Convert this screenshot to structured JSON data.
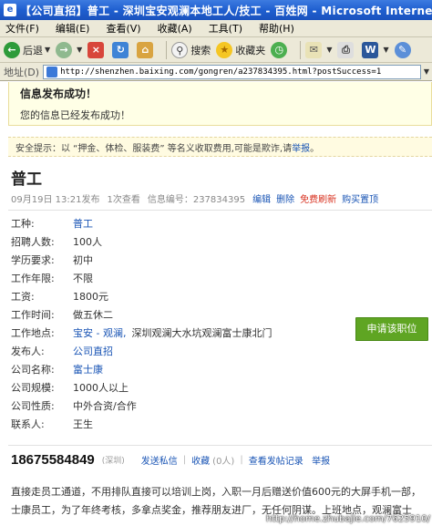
{
  "window": {
    "title": "【公司直招】普工 - 深圳宝安观澜本地工人/技工 - 百姓网 - Microsoft Internet"
  },
  "menu": [
    "文件(F)",
    "编辑(E)",
    "查看(V)",
    "收藏(A)",
    "工具(T)",
    "帮助(H)"
  ],
  "toolbar": {
    "back": "后退",
    "search": "搜索",
    "favorites": "收藏夹"
  },
  "address": {
    "label": "地址(D)",
    "url": "http://shenzhen.baixing.com/gongren/a237834395.html?postSuccess=1"
  },
  "notice": {
    "heading": "信息发布成功！",
    "body": "您的信息已经发布成功！"
  },
  "safety": {
    "text": "安全提示：以 “押金、体检、服装费” 等名义收取费用,可能是欺诈,请",
    "link": "举报",
    "end": "。"
  },
  "post": {
    "title": "普工",
    "date": "09月19日 13:21发布",
    "views": "1次查看",
    "id": "信息编号：237834395",
    "actions": {
      "edit": "编辑",
      "delete": "删除",
      "free_refresh": "免费刷新",
      "buy_top": "购买置顶"
    }
  },
  "fields": [
    {
      "key": "工种:",
      "value": "普工",
      "link": true
    },
    {
      "key": "招聘人数:",
      "value": "100人",
      "link": false
    },
    {
      "key": "学历要求:",
      "value": "初中",
      "link": false
    },
    {
      "key": "工作年限:",
      "value": "不限",
      "link": false
    },
    {
      "key": "工资:",
      "value": "1800元",
      "link": false
    },
    {
      "key": "工作时间:",
      "value": "做五休二",
      "link": false
    },
    {
      "key": "工作地点:",
      "value": "宝安 - 观澜,",
      "value2": "深圳观澜大水坑观澜富士康北门",
      "link": true
    },
    {
      "key": "发布人:",
      "value": "公司直招",
      "link": true
    },
    {
      "key": "公司名称:",
      "value": "富士康",
      "link": true
    },
    {
      "key": "公司规模:",
      "value": "1000人以上",
      "link": false
    },
    {
      "key": "公司性质:",
      "value": "中外合资/合作",
      "link": false
    },
    {
      "key": "联系人:",
      "value": "王生",
      "link": false
    }
  ],
  "apply_button": "申请该职位",
  "contact": {
    "phone": "18675584849",
    "city": "(深圳)",
    "send_message": "发送私信",
    "favorite": "收藏",
    "favorite_count": "(0人)",
    "view_posts": "查看发帖记录",
    "report": "举报"
  },
  "description": [
    "直接走员工通道，不用排队直接可以培训上岗，入职一月后赠送价值600元的大屏手机一部，",
    "士康员工，为了年终考核，多拿点奖金，推荐朋友进厂，无任何阴谋。上班地点，观澜富士"
  ],
  "watermark": "http://home.zhubajie.com/7625910/"
}
